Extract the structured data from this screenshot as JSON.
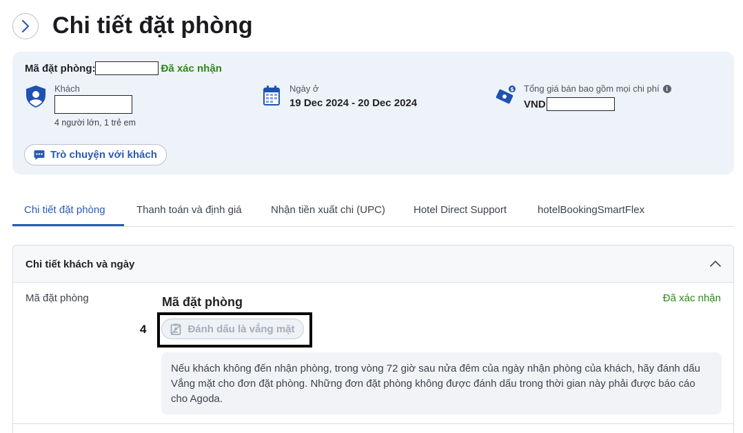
{
  "header": {
    "title": "Chi tiết đặt phòng"
  },
  "summary": {
    "booking_label": "Mã đặt phòng:",
    "booking_status": "Đã xác nhận",
    "guest": {
      "label": "Khách",
      "count": "4 người lớn, 1 trẻ em"
    },
    "stay": {
      "label": "Ngày ở",
      "dates": "19 Dec 2024 - 20 Dec 2024"
    },
    "price": {
      "label": "Tổng giá bán bao gồm mọi chi phí",
      "currency": "VND"
    },
    "chat_button": "Trò chuyện với khách"
  },
  "tabs": [
    {
      "label": "Chi tiết đặt phòng",
      "active": true
    },
    {
      "label": "Thanh toán và định giá",
      "active": false
    },
    {
      "label": "Nhận tiền xuất chi (UPC)",
      "active": false
    },
    {
      "label": "Hotel Direct Support",
      "active": false
    },
    {
      "label": "hotelBookingSmartFlex",
      "active": false
    }
  ],
  "panel": {
    "title": "Chi tiết khách và ngày",
    "row_label": "Mã đặt phòng",
    "row_title": "Mã đặt phòng",
    "row_status": "Đã xác nhận",
    "step_number": "4",
    "noshow_button": "Đánh dấu là vắng mặt",
    "info_text": "Nếu khách không đến nhận phòng, trong vòng 72 giờ sau nửa đêm của ngày nhận phòng của khách, hãy đánh dấu Vắng mặt cho đơn đặt phòng. Những đơn đặt phòng không được đánh dấu trong thời gian này phải được báo cáo cho Agoda."
  },
  "colors": {
    "accent": "#2a5ab3",
    "confirmed": "#2b8a16",
    "summary_bg": "#eef2f9"
  }
}
